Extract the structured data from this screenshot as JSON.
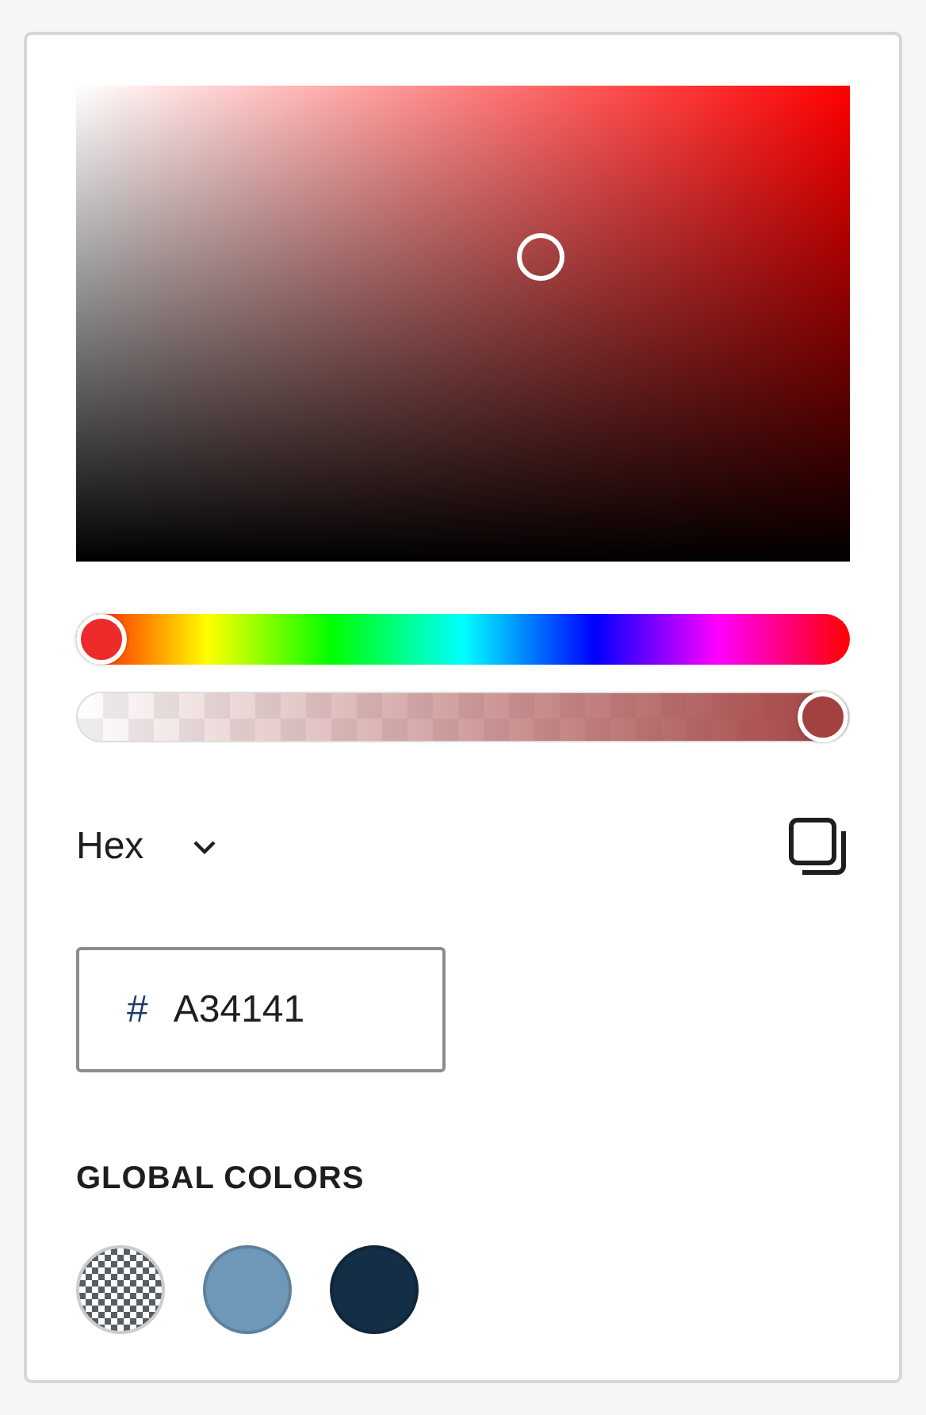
{
  "hue_slider": {
    "level": 0
  },
  "alpha_slider": {
    "level": 1
  },
  "format_select": {
    "value": "Hex"
  },
  "hex_input": {
    "prefix": "#",
    "value": "A34141"
  },
  "global_colors": {
    "heading": "GLOBAL COLORS",
    "swatches": [
      {
        "kind": "transparent"
      },
      {
        "kind": "solid",
        "color": "#6f98b8"
      },
      {
        "kind": "solid",
        "color": "#132e45"
      }
    ]
  }
}
